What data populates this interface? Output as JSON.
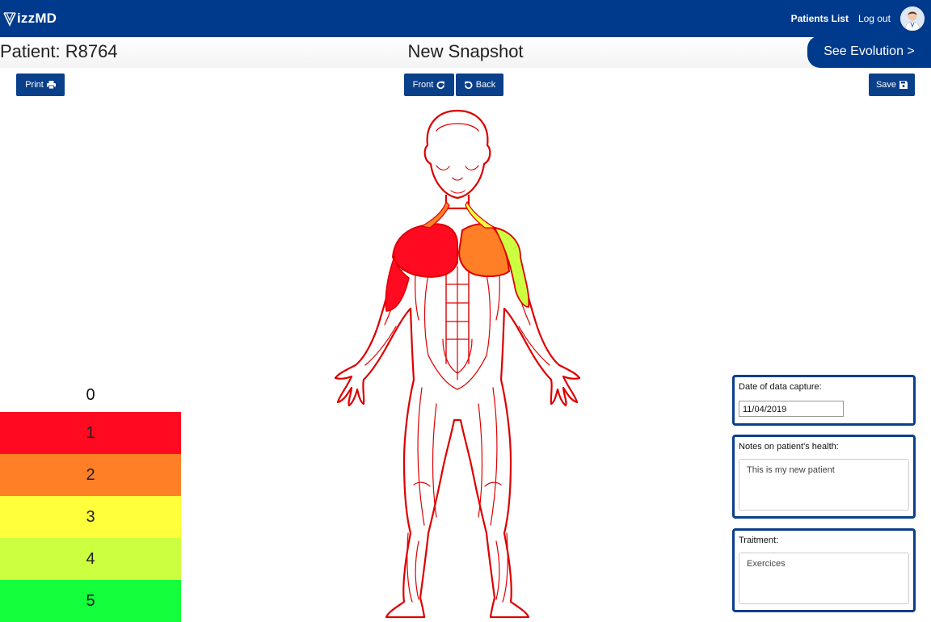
{
  "navbar": {
    "logo_text": "izzMD",
    "patients_list": "Patients List",
    "logout": "Log out",
    "background": "#003a8c"
  },
  "header": {
    "patient_title": "Patient: R8764",
    "snapshot_title": "New Snapshot",
    "see_evolution": "See Evolution >"
  },
  "toolbar": {
    "print_label": "Print",
    "print_icon": "printer-icon",
    "front_label": "Front",
    "front_icon": "rotate-right-icon",
    "back_label": "Back",
    "back_icon": "rotate-left-icon",
    "save_label": "Save",
    "save_icon": "floppy-disk-icon"
  },
  "legend": {
    "zero": "0",
    "levels": [
      {
        "label": "1",
        "color": "#ff0a21"
      },
      {
        "label": "2",
        "color": "#ff7f27"
      },
      {
        "label": "3",
        "color": "#ffff3b"
      },
      {
        "label": "4",
        "color": "#ccff40"
      },
      {
        "label": "5",
        "color": "#14ff3c"
      }
    ]
  },
  "figure": {
    "outline_color": "#dd0000",
    "left_shoulder_level": "1",
    "right_shoulder_level": "2",
    "right_arm_level": "4"
  },
  "form": {
    "date_label": "Date of data capture:",
    "date_value": "11/04/2019",
    "notes_label": "Notes on patient's health:",
    "notes_value": "This is my new patient",
    "treatment_label": "Traitment:",
    "treatment_value": "Exercices"
  }
}
